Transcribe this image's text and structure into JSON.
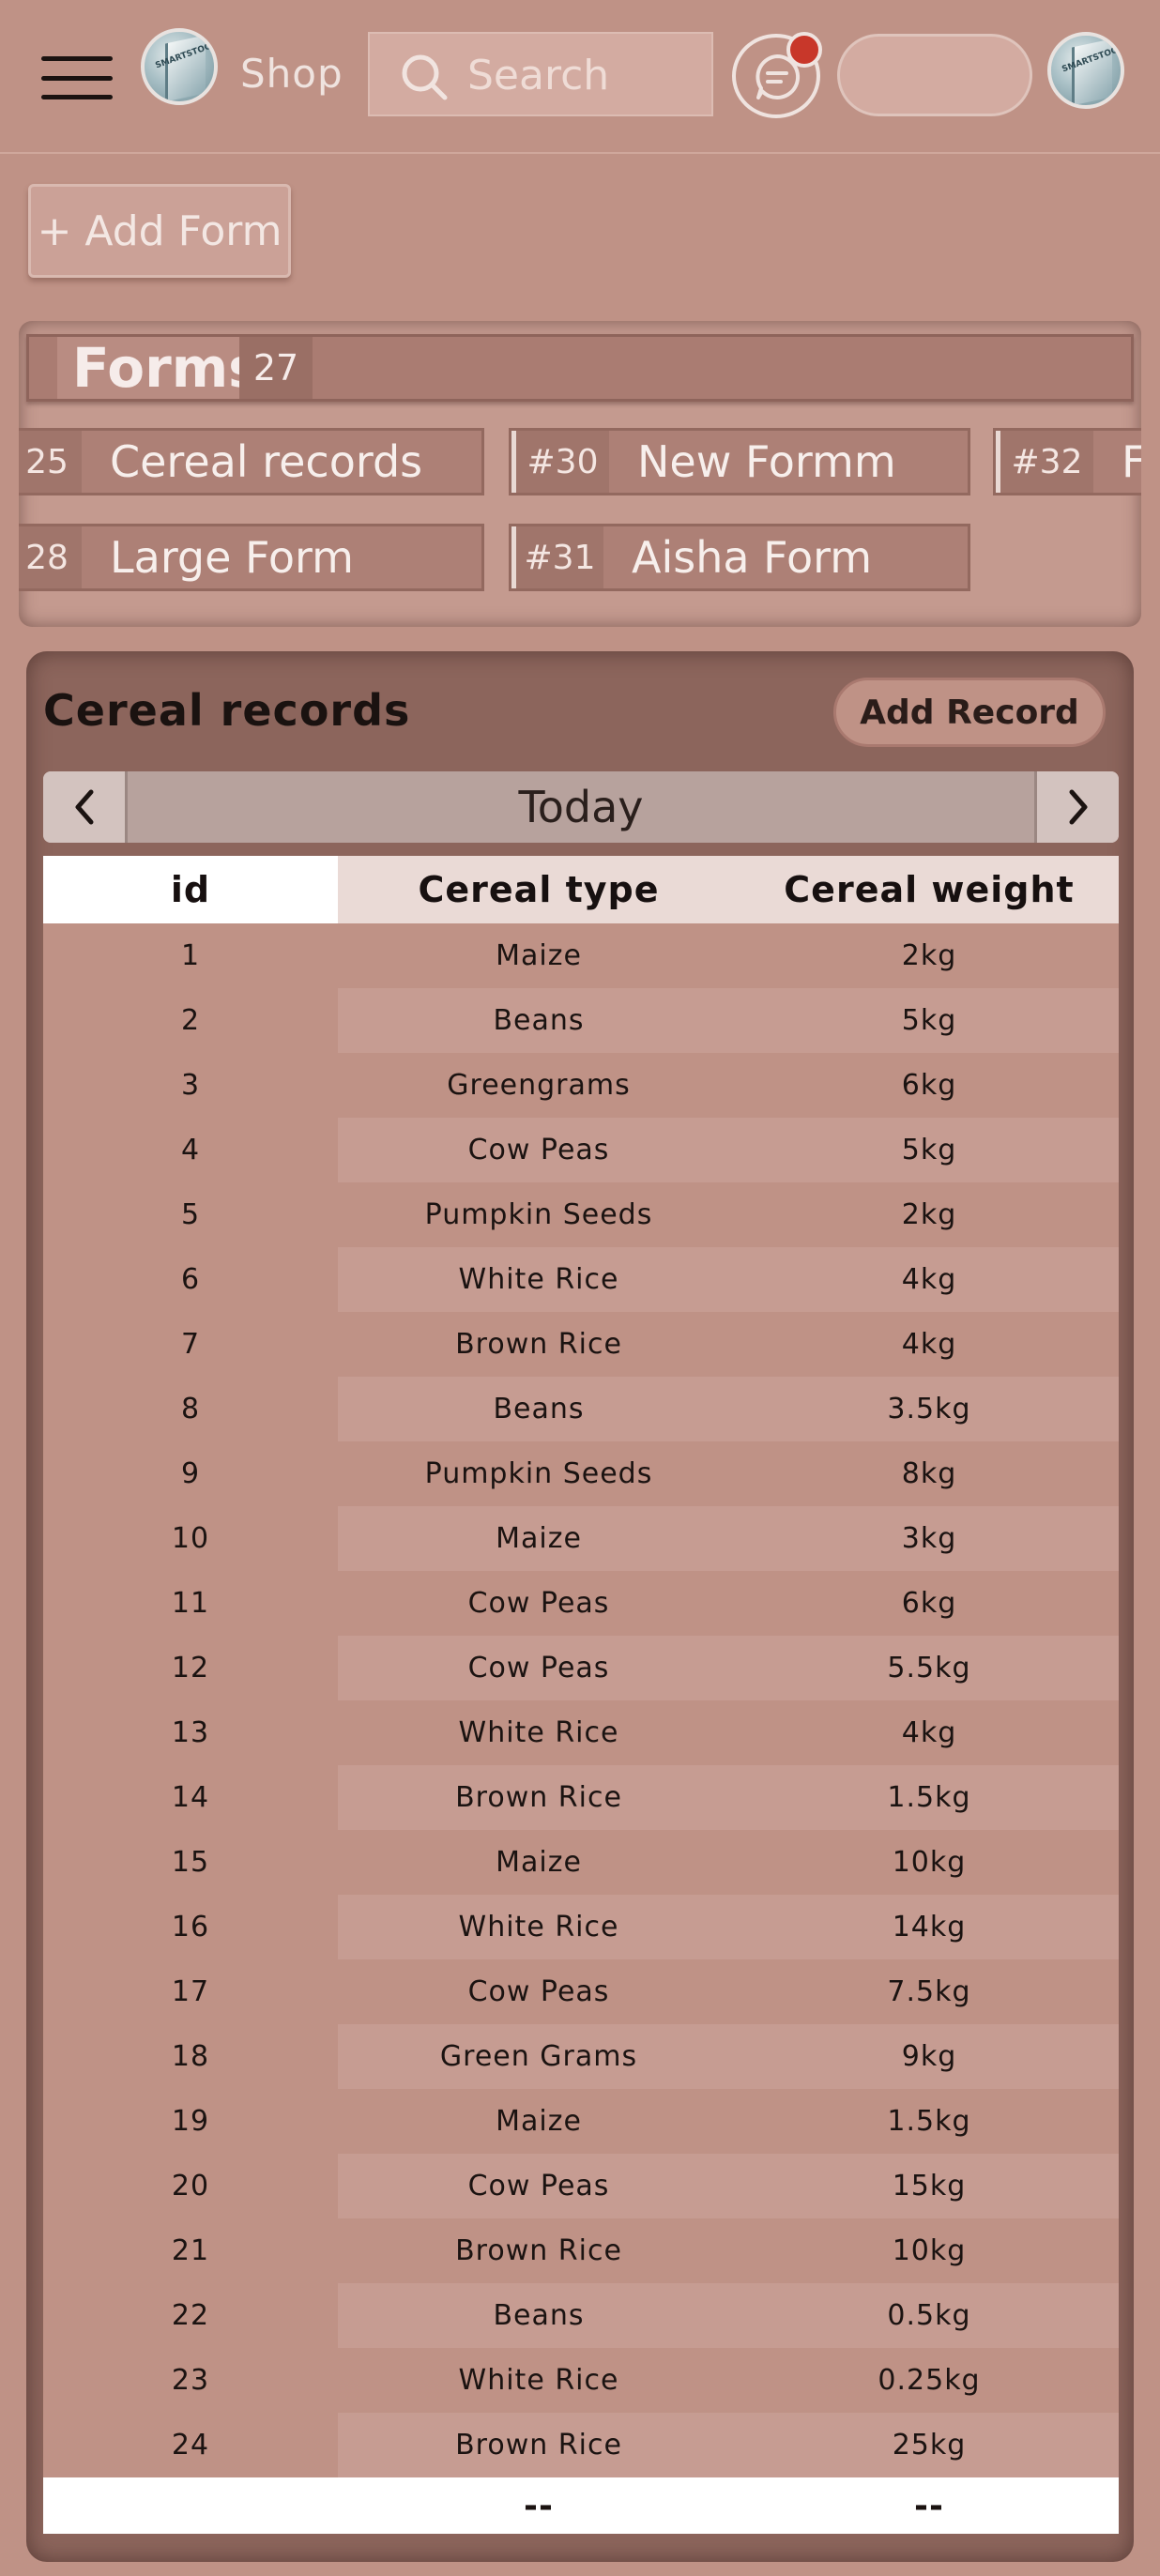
{
  "topbar": {
    "shop_label": "Shop",
    "search_placeholder": "Search",
    "has_notification": true
  },
  "forms_panel": {
    "add_form_label": "+ Add Form",
    "title": "Forms",
    "count": "27",
    "chips": [
      {
        "num": "25",
        "name": "Cereal records"
      },
      {
        "num": "#30",
        "name": "New Formm"
      },
      {
        "num": "#32",
        "name": "F"
      },
      {
        "num": "28",
        "name": "Large Form"
      },
      {
        "num": "#31",
        "name": "Aisha Form"
      }
    ]
  },
  "records": {
    "title": "Cereal records",
    "add_record_label": "Add Record",
    "date_label": "Today",
    "columns": [
      "id",
      "Cereal type",
      "Cereal weight"
    ],
    "rows": [
      [
        "1",
        "Maize",
        "2kg"
      ],
      [
        "2",
        "Beans",
        "5kg"
      ],
      [
        "3",
        "Greengrams",
        "6kg"
      ],
      [
        "4",
        "Cow Peas",
        "5kg"
      ],
      [
        "5",
        "Pumpkin Seeds",
        "2kg"
      ],
      [
        "6",
        "White Rice",
        "4kg"
      ],
      [
        "7",
        "Brown Rice",
        "4kg"
      ],
      [
        "8",
        "Beans",
        "3.5kg"
      ],
      [
        "9",
        "Pumpkin Seeds",
        "8kg"
      ],
      [
        "10",
        "Maize",
        "3kg"
      ],
      [
        "11",
        "Cow Peas",
        "6kg"
      ],
      [
        "12",
        "Cow Peas",
        "5.5kg"
      ],
      [
        "13",
        "White Rice",
        "4kg"
      ],
      [
        "14",
        "Brown Rice",
        "1.5kg"
      ],
      [
        "15",
        "Maize",
        "10kg"
      ],
      [
        "16",
        "White Rice",
        "14kg"
      ],
      [
        "17",
        "Cow Peas",
        "7.5kg"
      ],
      [
        "18",
        "Green Grams",
        "9kg"
      ],
      [
        "19",
        "Maize",
        "1.5kg"
      ],
      [
        "20",
        "Cow Peas",
        "15kg"
      ],
      [
        "21",
        "Brown Rice",
        "10kg"
      ],
      [
        "22",
        "Beans",
        "0.5kg"
      ],
      [
        "23",
        "White Rice",
        "0.25kg"
      ],
      [
        "24",
        "Brown Rice",
        "25kg"
      ]
    ],
    "footer": [
      "",
      "--",
      "--"
    ]
  },
  "colors": {
    "background": "#bf9286",
    "panel_dark": "#8c655c",
    "notification": "#c8372a"
  }
}
